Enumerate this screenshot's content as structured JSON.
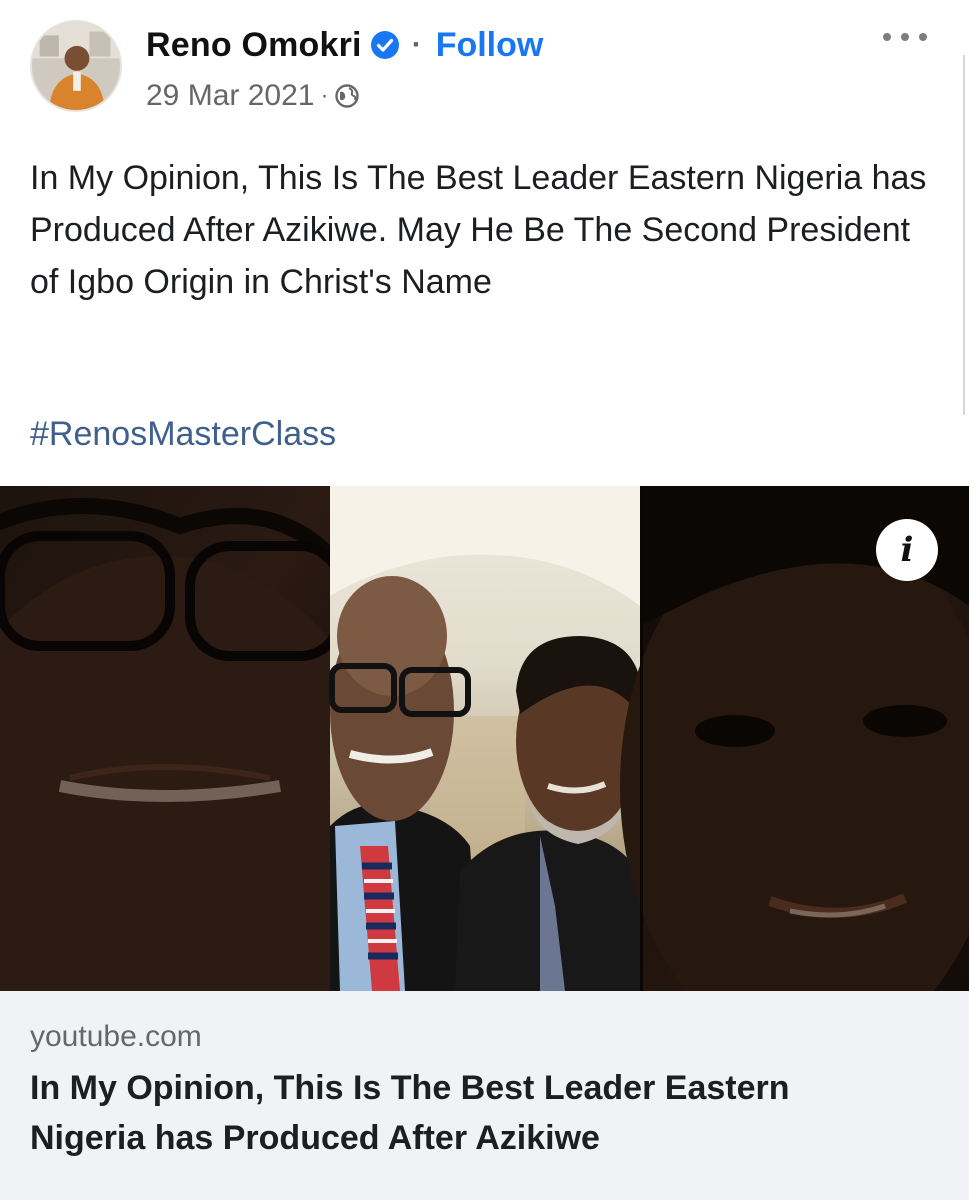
{
  "author": {
    "name": "Reno Omokri",
    "verified_icon": "verified-badge-icon",
    "separator": "·",
    "follow_label": "Follow"
  },
  "meta": {
    "date": "29 Mar 2021",
    "separator": "·",
    "audience_icon": "globe-icon"
  },
  "more_icon": "more-options-icon",
  "post": {
    "text": "In My Opinion, This Is The Best Leader Eastern Nigeria has Produced After Azikiwe. May He Be The Second President of Igbo Origin in Christ's Name",
    "hashtag": "#RenosMasterClass"
  },
  "link_preview": {
    "info_label": "i",
    "domain": "youtube.com",
    "title": "In My Opinion, This Is The Best Leader Eastern Nigeria has Produced After Azikiwe"
  },
  "colors": {
    "link_blue": "#1877f2",
    "hashtag": "#3f5f8c",
    "caption_bg": "#f0f2f5",
    "meta_grey": "#65676b"
  }
}
